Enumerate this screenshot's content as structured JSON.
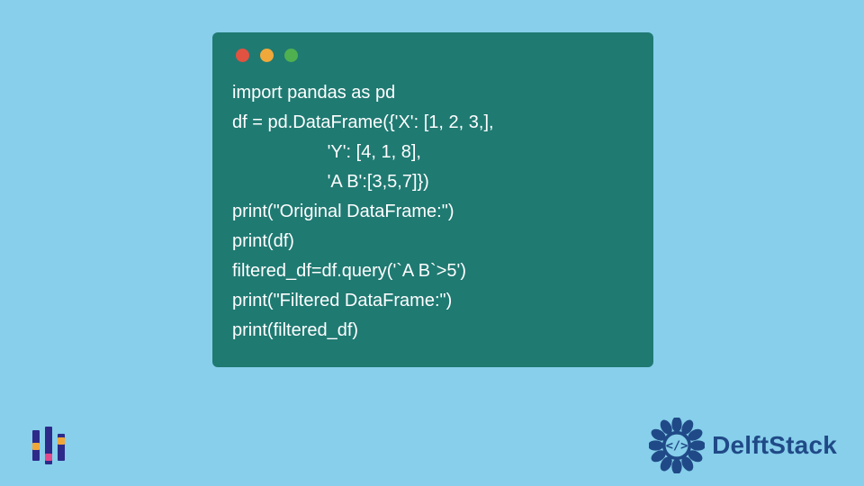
{
  "code": {
    "lines": [
      "import pandas as pd",
      "df = pd.DataFrame({'X': [1, 2, 3,],",
      "                   'Y': [4, 1, 8],",
      "                   'A B':[3,5,7]})",
      "print(\"Original DataFrame:\")",
      "print(df)",
      "filtered_df=df.query('`A B`>5')",
      "print(\"Filtered DataFrame:\")",
      "print(filtered_df)"
    ]
  },
  "window_controls": {
    "red": "#e15241",
    "yellow": "#f1a83a",
    "green": "#4fb04f"
  },
  "brand": {
    "name": "DelftStack"
  }
}
